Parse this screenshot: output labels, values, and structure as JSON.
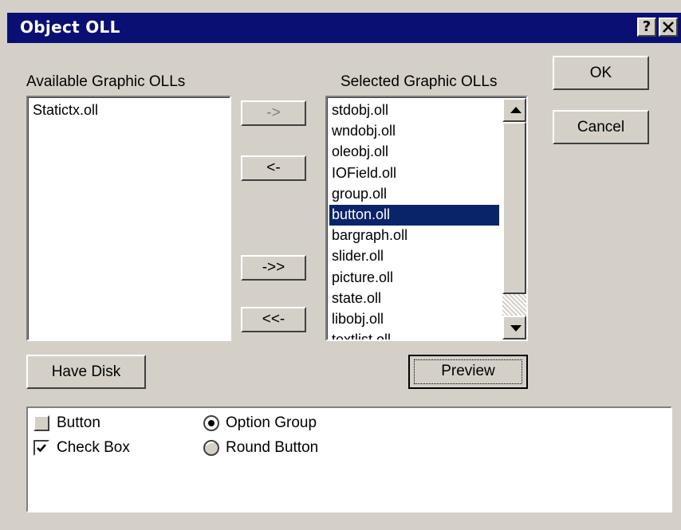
{
  "window": {
    "title": "Object OLL",
    "help_button": "?",
    "close_button": "X"
  },
  "available": {
    "label": "Available Graphic OLLs",
    "items": [
      "Statictx.oll"
    ]
  },
  "selected": {
    "label": "Selected Graphic OLLs",
    "items": [
      {
        "text": "stdobj.oll",
        "selected": false
      },
      {
        "text": "wndobj.oll",
        "selected": false
      },
      {
        "text": "oleobj.oll",
        "selected": false
      },
      {
        "text": "IOField.oll",
        "selected": false
      },
      {
        "text": "group.oll",
        "selected": false
      },
      {
        "text": "button.oll",
        "selected": true
      },
      {
        "text": "bargraph.oll",
        "selected": false
      },
      {
        "text": "slider.oll",
        "selected": false
      },
      {
        "text": "picture.oll",
        "selected": false
      },
      {
        "text": "state.oll",
        "selected": false
      },
      {
        "text": "libobj.oll",
        "selected": false
      },
      {
        "text": "textlist.oll",
        "selected": false
      }
    ]
  },
  "buttons": {
    "ok": "OK",
    "cancel": "Cancel",
    "add": "->",
    "remove": "<-",
    "add_all": "->>",
    "remove_all": "<<-",
    "have_disk": "Have Disk",
    "preview": "Preview"
  },
  "preview_controls": {
    "button_label": "Button",
    "check_box_label": "Check Box",
    "option_group_label": "Option Group",
    "round_button_label": "Round Button"
  },
  "colors": {
    "title_bar": "#0a1073",
    "dialog_face": "#d4d0c8",
    "selection": "#0a246a"
  }
}
